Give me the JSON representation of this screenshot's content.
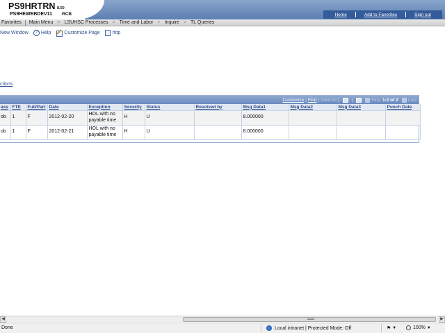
{
  "header": {
    "brand": "PS9HRTRN",
    "version": "8.50",
    "server": "PS9HEWEBDEV11",
    "user": "RCB",
    "links": [
      "Home",
      "Add to Favorites",
      "Sign out"
    ]
  },
  "nav": {
    "items": [
      "Favorites",
      "Main Menu",
      "LSUHSC Processes",
      "Time and Labor",
      "Inquire",
      "TL Queries"
    ]
  },
  "toolbar": {
    "new_window": "New Window",
    "help": "Help",
    "customize": "Customize Page",
    "http": "http"
  },
  "actions_link": "ctions",
  "grid": {
    "customize": "Customize",
    "find": "Find",
    "view_all": "View All",
    "first": "First",
    "range": "1-2 of 2",
    "last": "Last",
    "columns": [
      "ass",
      "FTE",
      "Full/Part",
      "Date",
      "Exception",
      "Severity",
      "Status",
      "Resolved by",
      "Msg Data1",
      "Msg Data2",
      "Msg Data3",
      "Punch Date"
    ],
    "rows": [
      [
        "ob",
        "1",
        "F",
        "2012-02-20",
        "HOL with no payable time",
        "H",
        "U",
        "",
        "8.000000",
        "",
        "",
        ""
      ],
      [
        "ob",
        "1",
        "F",
        "2012-02-21",
        "HOL with no payable time",
        "H",
        "U",
        "",
        "8.000000",
        "",
        "",
        ""
      ]
    ]
  },
  "statusbar": {
    "status": "Done",
    "zone": "Local intranet | Protected Mode: Off",
    "zoom": "100%"
  },
  "colors": {
    "header_blue": "#5b7fb2",
    "link_blue": "#2d4c8c",
    "grid_header": "#6a8bbf"
  }
}
